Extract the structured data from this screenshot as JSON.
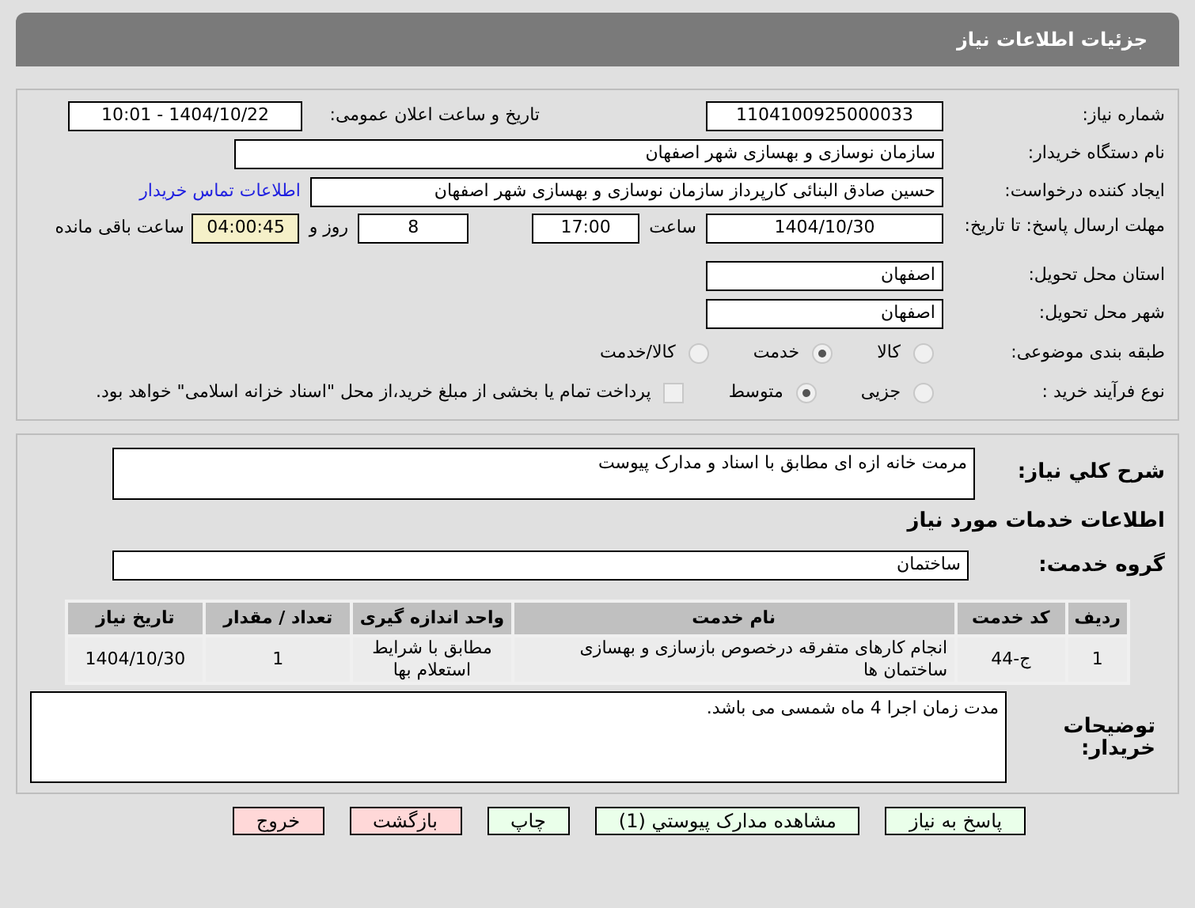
{
  "header": {
    "title": "جزئیات اطلاعات نیاز"
  },
  "need_number": {
    "label": "شماره نیاز:",
    "value": "1104100925000033"
  },
  "announce_date": {
    "label": "تاریخ و ساعت اعلان عمومی:",
    "value": "1404/10/22 - 10:01"
  },
  "buyer_org": {
    "label": "نام دستگاه خریدار:",
    "value": "سازمان نوسازی و بهسازی شهر اصفهان"
  },
  "requester": {
    "label": "ایجاد کننده درخواست:",
    "value": "حسین صادق البنائی کارپرداز سازمان نوسازی و بهسازی شهر اصفهان",
    "link": "اطلاعات تماس خریدار"
  },
  "deadline": {
    "label": "مهلت ارسال پاسخ: تا تاریخ:",
    "date": "1404/10/30",
    "time_label": "ساعت",
    "time": "17:00",
    "days": "8",
    "days_label": "روز و",
    "remaining": "04:00:45",
    "remaining_label": "ساعت باقی مانده"
  },
  "province": {
    "label": "استان محل تحویل:",
    "value": "اصفهان"
  },
  "city": {
    "label": "شهر محل تحویل:",
    "value": "اصفهان"
  },
  "category": {
    "label": "طبقه بندی موضوعی:",
    "options": [
      {
        "label": "کالا",
        "selected": false
      },
      {
        "label": "خدمت",
        "selected": true
      },
      {
        "label": "کالا/خدمت",
        "selected": false
      }
    ]
  },
  "purchase_process": {
    "label": "نوع فرآیند خرید :",
    "options": [
      {
        "label": "جزیی",
        "selected": false
      },
      {
        "label": "متوسط",
        "selected": true
      }
    ],
    "treasury": {
      "label": "پرداخت تمام یا بخشی از مبلغ خرید،از محل \"اسناد خزانه اسلامی\" خواهد بود.",
      "checked": false
    }
  },
  "description": {
    "label": "شرح کلي نياز:",
    "value": "مرمت خانه ازه ای مطابق با اسناد و مدارک پیوست"
  },
  "services_title": "اطلاعات خدمات مورد نیاز",
  "service_group": {
    "label": "گروه خدمت:",
    "value": "ساختمان"
  },
  "table": {
    "columns": [
      "ردیف",
      "کد خدمت",
      "نام خدمت",
      "واحد اندازه گیری",
      "تعداد / مقدار",
      "تاریخ نیاز"
    ],
    "rows": [
      [
        "1",
        "ج-44",
        "انجام کارهای متفرقه درخصوص بازسازی و بهسازی ساختمان ها",
        "مطابق با شرایط استعلام بها",
        "1",
        "1404/10/30"
      ]
    ]
  },
  "buyer_notes": {
    "label": "توضیحات خریدار:",
    "value": "مدت زمان اجرا 4 ماه شمسی می باشد."
  },
  "buttons": [
    {
      "label": "پاسخ به نیاز",
      "kind": "normal"
    },
    {
      "label": "مشاهده مدارک پیوستي (1)",
      "kind": "normal"
    },
    {
      "label": "چاپ",
      "kind": "normal"
    },
    {
      "label": "بازگشت",
      "kind": "danger"
    },
    {
      "label": "خروج",
      "kind": "danger"
    }
  ]
}
